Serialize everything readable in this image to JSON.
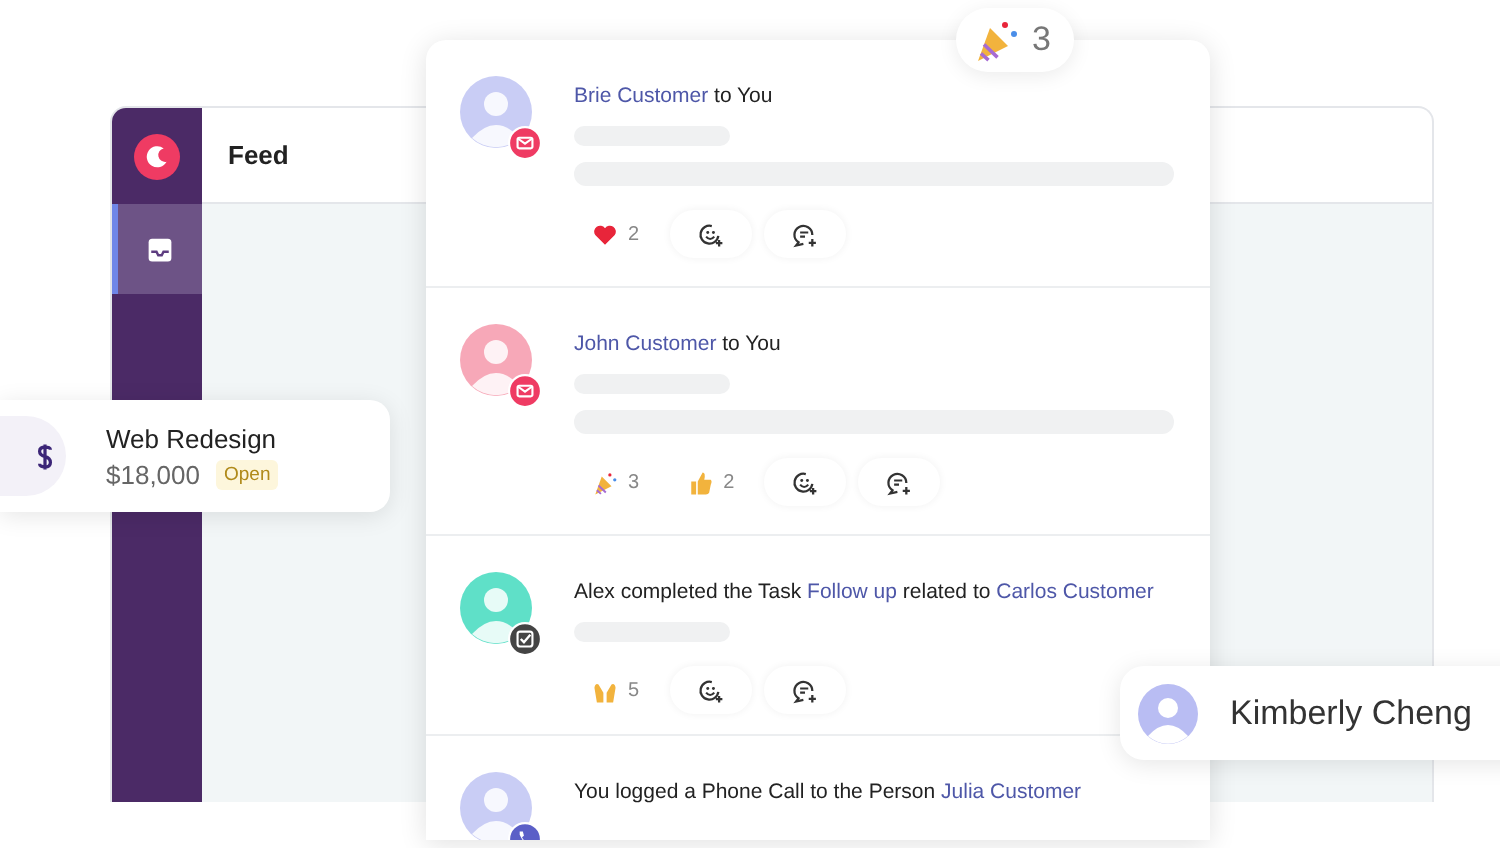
{
  "window": {
    "title": "Feed"
  },
  "sidebar": {
    "items": [
      {
        "selected": true
      }
    ]
  },
  "celebration_badge": {
    "count": "3"
  },
  "feed": [
    {
      "avatar": {
        "color": "#c9cdf5"
      },
      "badge": {
        "kind": "mail"
      },
      "title": [
        {
          "kind": "link",
          "text": "Brie Customer"
        },
        {
          "kind": "text",
          "text": "to You"
        }
      ],
      "loading_lines": [
        {
          "kind": "short"
        },
        {
          "kind": "long"
        }
      ],
      "reactions": [
        {
          "kind": "heart",
          "count": "2"
        }
      ]
    },
    {
      "avatar": {
        "color": "#f7a8b8"
      },
      "badge": {
        "kind": "mail"
      },
      "title": [
        {
          "kind": "link",
          "text": "John Customer"
        },
        {
          "kind": "text",
          "text": "to You"
        }
      ],
      "loading_lines": [
        {
          "kind": "short"
        },
        {
          "kind": "long"
        }
      ],
      "reactions": [
        {
          "kind": "party",
          "count": "3"
        },
        {
          "kind": "thumbs",
          "count": "2"
        }
      ]
    },
    {
      "avatar": {
        "color": "#5fe0c8"
      },
      "badge": {
        "kind": "task"
      },
      "title": [
        {
          "kind": "text",
          "text": "Alex completed the Task"
        },
        {
          "kind": "link",
          "text": "Follow up"
        },
        {
          "kind": "text",
          "text": "related to"
        },
        {
          "kind": "link",
          "text": "Carlos Customer"
        }
      ],
      "loading_lines": [
        {
          "kind": "short"
        }
      ],
      "reactions": [
        {
          "kind": "hands",
          "count": "5"
        }
      ]
    },
    {
      "avatar": {
        "color": "#c9cdf5"
      },
      "badge": {
        "kind": "phone"
      },
      "title": [
        {
          "kind": "text",
          "text": "You logged a Phone Call to the Person"
        },
        {
          "kind": "link",
          "text": "Julia Customer"
        }
      ]
    }
  ],
  "deal_card": {
    "title": "Web Redesign",
    "amount": "$18,000",
    "status": "Open"
  },
  "person_card": {
    "name": "Kimberly Cheng"
  }
}
